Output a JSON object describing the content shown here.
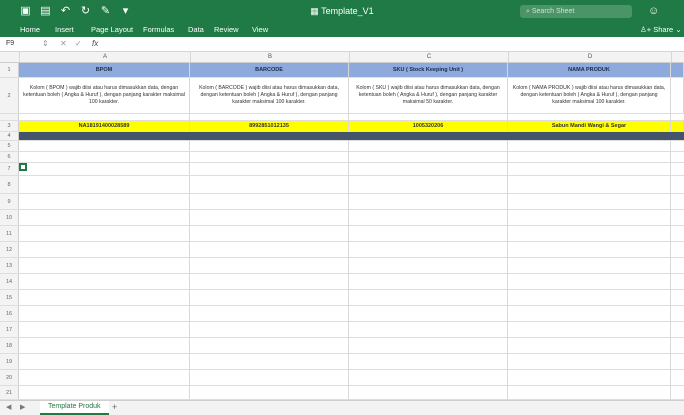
{
  "titlebar": {
    "title": "Template_V1",
    "search_placeholder": "Search Sheet",
    "icons": [
      "sidebar-icon",
      "save-icon",
      "undo-icon",
      "redo-icon",
      "edit-icon",
      "customize-icon",
      "file-icon",
      "smiley-icon"
    ]
  },
  "ribbon": {
    "tabs": [
      "Home",
      "Insert",
      "Page Layout",
      "Formulas",
      "Data",
      "Review",
      "View"
    ],
    "share": "Share"
  },
  "formula_bar": {
    "cell_ref": "F9",
    "fx": "fx",
    "value": ""
  },
  "columns": {
    "headers": [
      "A",
      "B",
      "C",
      "D"
    ]
  },
  "rows": {
    "numbers": [
      "1",
      "2",
      "3",
      "4",
      "5",
      "6",
      "7",
      "8",
      "9",
      "10",
      "11",
      "12",
      "13",
      "14",
      "15",
      "16",
      "17",
      "18",
      "19",
      "20",
      "21",
      "22",
      "23",
      "24"
    ],
    "header": [
      "BPOM",
      "BARCODE",
      "SKU ( Stock Keeping Unit )",
      "NAMA PRODUK"
    ],
    "description": [
      "Kolom ( BPOM ) wajib diisi atau harus dimasukkan data, dengan ketentuan boleh ( Angka & Huruf ), dengan panjang karakter maksimal 100 karakter.",
      "Kolom ( BARCODE ) wajib diisi atau harus dimasukkan data, dengan ketentuan boleh ( Angka & Huruf ), dengan panjang karakter maksimal 100 karakter.",
      "Kolom ( SKU ) wajib diisi atau harus dimasukkan data, dengan ketentuan boleh ( Angka & Huruf ), dengan panjang karakter maksimal 50 karakter.",
      "Kolom ( NAMA PRODUK ) wajib diisi atau harus dimasukkan data, dengan ketentuan boleh ( Angka & Huruf ), dengan panjang karakter maksimal 100 karakter."
    ],
    "sample": [
      "NA18191400028589",
      "8992851012135",
      "1005320206",
      "Sabun Mandi Wangi & Segar"
    ]
  },
  "sheets": {
    "tabs": [
      "Template Produk"
    ],
    "add": "+"
  },
  "colors": {
    "accent": "#1f7a45",
    "header_fill": "#8ea9db",
    "highlight": "#ffff00",
    "dark_band": "#44546a"
  }
}
